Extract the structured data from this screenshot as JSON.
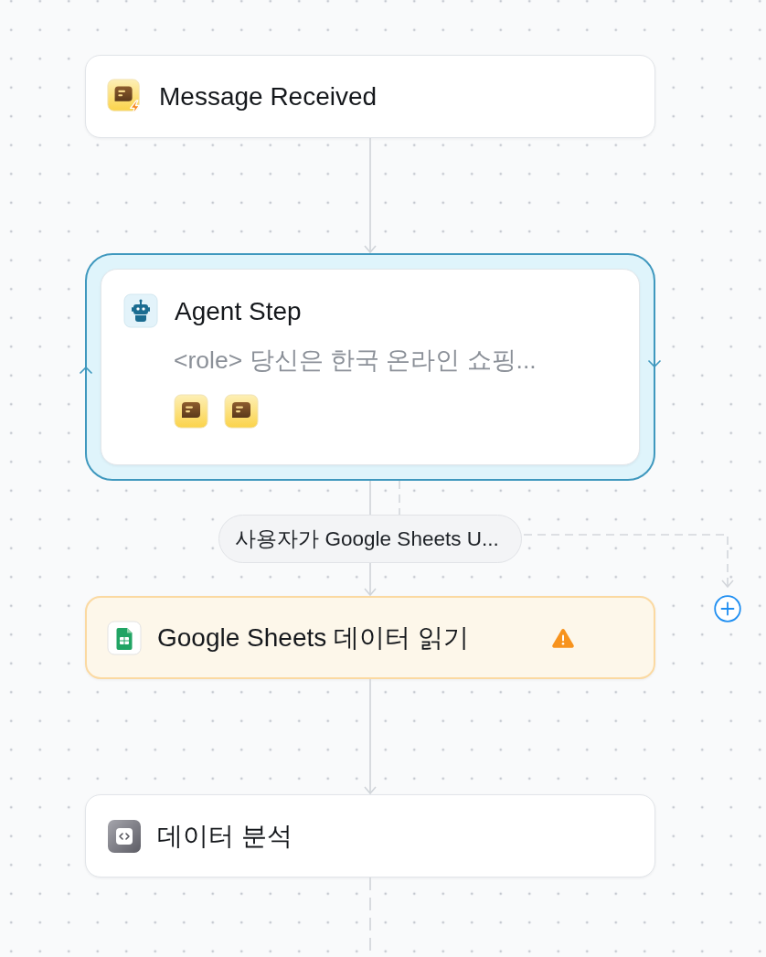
{
  "canvas": {
    "steps": [
      {
        "kind": "trigger",
        "title": "Message Received"
      },
      {
        "kind": "agent",
        "title": "Agent Step",
        "description": "<role> 당신은 한국 온라인 쇼핑...",
        "loop": true,
        "tools": [
          {
            "kind": "message"
          },
          {
            "kind": "message"
          }
        ],
        "branch": {
          "label": "사용자가 Google Sheets U...",
          "open_branch": true
        }
      },
      {
        "kind": "sheets",
        "title": "Google Sheets 데이터 읽기",
        "warning": true
      },
      {
        "kind": "code",
        "title": "데이터 분석",
        "continues": true
      }
    ]
  }
}
